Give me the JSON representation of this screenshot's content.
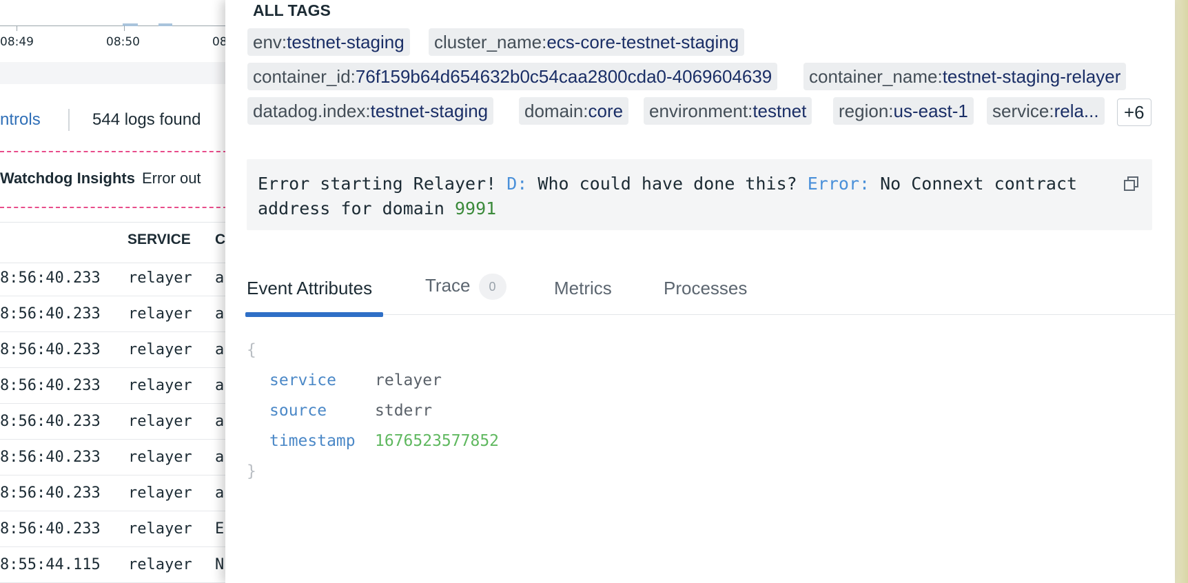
{
  "timeline": {
    "ticks": [
      "08:49",
      "08:50",
      "08"
    ]
  },
  "controls": {
    "link_label": "ntrols",
    "logs_found": "544 logs found"
  },
  "watchdog": {
    "title": "Watchdog Insights",
    "text": "Error out"
  },
  "log_table": {
    "columns": [
      "SERVICE",
      "C"
    ],
    "rows": [
      {
        "time": "8:56:40.233",
        "service": "relayer",
        "msg": "a"
      },
      {
        "time": "8:56:40.233",
        "service": "relayer",
        "msg": "a"
      },
      {
        "time": "8:56:40.233",
        "service": "relayer",
        "msg": "a"
      },
      {
        "time": "8:56:40.233",
        "service": "relayer",
        "msg": "a"
      },
      {
        "time": "8:56:40.233",
        "service": "relayer",
        "msg": "a"
      },
      {
        "time": "8:56:40.233",
        "service": "relayer",
        "msg": "a"
      },
      {
        "time": "8:56:40.233",
        "service": "relayer",
        "msg": "a"
      },
      {
        "time": "8:56:40.233",
        "service": "relayer",
        "msg": "E"
      },
      {
        "time": "8:55:44.115",
        "service": "relayer",
        "msg": "N"
      }
    ]
  },
  "panel": {
    "all_tags_title": "ALL TAGS",
    "tags": [
      {
        "key": "env:",
        "value": "testnet-staging"
      },
      {
        "key": "cluster_name:",
        "value": "ecs-core-testnet-staging"
      },
      {
        "key": "container_id:",
        "value": "76f159b64d654632b0c54caa2800cda0-4069604639"
      },
      {
        "key": "container_name:",
        "value": "testnet-staging-relayer"
      },
      {
        "key": "datadog.index:",
        "value": "testnet-staging"
      },
      {
        "key": "domain:",
        "value": "core"
      },
      {
        "key": "environment:",
        "value": "testnet"
      },
      {
        "key": "region:",
        "value": "us-east-1"
      },
      {
        "key": "service:",
        "value": "rela..."
      }
    ],
    "more_tags": "+6",
    "message": {
      "part1": "Error starting Relayer! ",
      "label_d": "D:",
      "part2": " Who could have done this? ",
      "label_error": "Error:",
      "part3": " No Connext contract",
      "part4": "address for domain ",
      "domain_number": "9991"
    },
    "tabs": [
      {
        "label": "Event Attributes"
      },
      {
        "label": "Trace",
        "badge": "0"
      },
      {
        "label": "Metrics"
      },
      {
        "label": "Processes"
      }
    ],
    "attributes": {
      "open_brace": "{",
      "close_brace": "}",
      "items": [
        {
          "key": "service",
          "value": "relayer"
        },
        {
          "key": "source",
          "value": "stderr"
        },
        {
          "key": "timestamp",
          "value": "1676523577852"
        }
      ]
    }
  }
}
